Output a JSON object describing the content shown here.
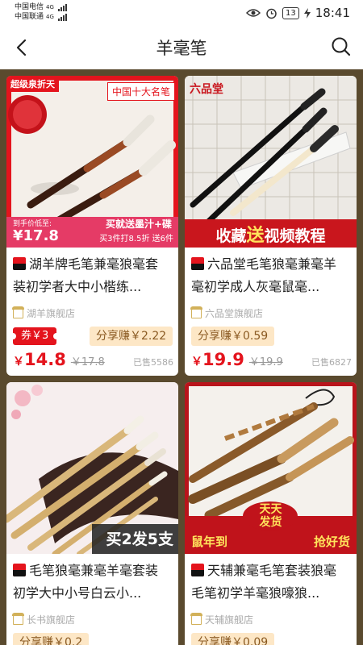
{
  "status_bar": {
    "carrier1": "中国电信",
    "carrier1_net": "4G",
    "carrier2": "中国联通",
    "carrier2_net": "4G",
    "battery": "13",
    "time": "18:41"
  },
  "header": {
    "title": "羊毫笔",
    "back_icon": "chevron-left-icon",
    "search_icon": "search-icon"
  },
  "products": [
    {
      "image_badge": "超级泉折天",
      "image_tag": "中国十大名笔",
      "image_price_label": "到手价低至:",
      "image_price": "¥17.8",
      "image_promo": "买就送墨汁+碟",
      "image_promo2": "买3件打8.5折 送6件",
      "title_line1": "湖羊牌毛笔兼毫狼毫套",
      "title_line2": "装初学者大中小楷练...",
      "shop": "湖羊旗舰店",
      "coupon": "券￥3",
      "share": "分享赚￥2.22",
      "currency": "￥",
      "price": "14.8",
      "original_price": "￥17.8",
      "sold": "已售5586"
    },
    {
      "image_logo": "六品堂",
      "image_banner_a": "收藏",
      "image_banner_b": "送",
      "image_banner_c": "视频教程",
      "title_line1": "六品堂毛笔狼毫兼毫羊",
      "title_line2": "毫初学成人灰毫鼠毫...",
      "shop": "六品堂旗舰店",
      "share": "分享赚￥0.59",
      "currency": "￥",
      "price": "19.9",
      "original_price": "￥19.9",
      "sold": "已售6827"
    },
    {
      "image_banner": "买2发5支",
      "title_line1": "毛笔狼毫兼毫羊毫套装",
      "title_line2": "初学大中小号白云小...",
      "shop": "长书旗舰店",
      "share": "分享赚￥0.2"
    },
    {
      "image_tag1": "天天",
      "image_tag2": "发货",
      "image_left": "鼠年到",
      "image_right": "抢好货",
      "title_line1": "天辅兼毫毛笔套装狼毫",
      "title_line2": "毛笔初学羊毫狼嚎狼...",
      "shop": "天辅旗舰店",
      "share": "分享赚￥0.09"
    }
  ],
  "colors": {
    "accent_red": "#e4141d",
    "share_bg": "#fde7c6",
    "page_bg": "#5a4a2e"
  }
}
